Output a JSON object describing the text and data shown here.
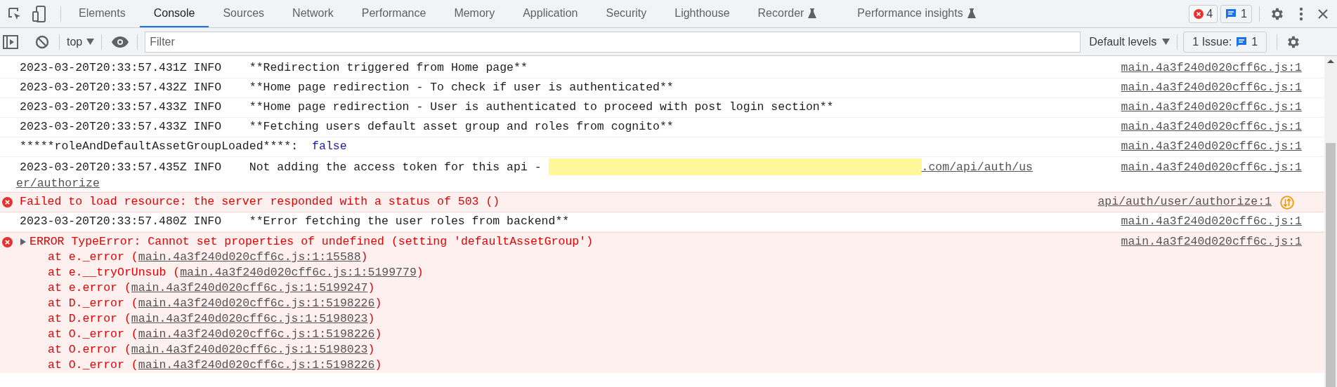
{
  "tabs": [
    {
      "label": "Elements",
      "selected": false,
      "experimental": false
    },
    {
      "label": "Console",
      "selected": true,
      "experimental": false
    },
    {
      "label": "Sources",
      "selected": false,
      "experimental": false
    },
    {
      "label": "Network",
      "selected": false,
      "experimental": false
    },
    {
      "label": "Performance",
      "selected": false,
      "experimental": false
    },
    {
      "label": "Memory",
      "selected": false,
      "experimental": false
    },
    {
      "label": "Application",
      "selected": false,
      "experimental": false
    },
    {
      "label": "Security",
      "selected": false,
      "experimental": false
    },
    {
      "label": "Lighthouse",
      "selected": false,
      "experimental": false
    },
    {
      "label": "Recorder",
      "selected": false,
      "experimental": true
    },
    {
      "label": "Performance insights",
      "selected": false,
      "experimental": true
    }
  ],
  "error_count": "4",
  "message_count": "1",
  "toolbar": {
    "context": "top",
    "filter_placeholder": "Filter",
    "levels": "Default levels",
    "issues_label": "1 Issue:",
    "issues_count": "1"
  },
  "entries": [
    {
      "kind": "info",
      "text": "2023-03-20T20:33:57.431Z INFO    **Redirection triggered from Home page**",
      "source": "main.4a3f240d020cff6c.js:1"
    },
    {
      "kind": "info",
      "text": "2023-03-20T20:33:57.432Z INFO    **Home page redirection - To check if user is authenticated**",
      "source": "main.4a3f240d020cff6c.js:1"
    },
    {
      "kind": "info",
      "text": "2023-03-20T20:33:57.433Z INFO    **Home page redirection - User is authenticated to proceed with post login section**",
      "source": "main.4a3f240d020cff6c.js:1"
    },
    {
      "kind": "info",
      "text": "2023-03-20T20:33:57.433Z INFO    **Fetching users default asset group and roles from cognito**",
      "source": "main.4a3f240d020cff6c.js:1"
    },
    {
      "kind": "value",
      "text": "*****roleAndDefaultAssetGroupLoaded****:",
      "value": "false",
      "source": "main.4a3f240d020cff6c.js:1"
    },
    {
      "kind": "redacted",
      "text": "2023-03-20T20:33:57.435Z INFO    Not adding the access token for this api - ",
      "url": ".com/api/auth/us",
      "url_continued": "er/authorize",
      "source": "main.4a3f240d020cff6c.js:1"
    },
    {
      "kind": "network_error",
      "text": "Failed to load resource: the server responded with a status of 503 ()",
      "source": "api/auth/user/authorize:1"
    },
    {
      "kind": "info",
      "text": "2023-03-20T20:33:57.480Z INFO    **Error fetching the user roles from backend**",
      "source": "main.4a3f240d020cff6c.js:1"
    },
    {
      "kind": "error",
      "expanded": false,
      "text": "ERROR TypeError: Cannot set properties of undefined (setting 'defaultAssetGroup')",
      "source": "main.4a3f240d020cff6c.js:1",
      "stack": [
        {
          "call": "at e._error (",
          "location": "main.4a3f240d020cff6c.js:1:15588",
          "close": ")"
        },
        {
          "call": "at e.__tryOrUnsub (",
          "location": "main.4a3f240d020cff6c.js:1:5199779",
          "close": ")"
        },
        {
          "call": "at e.error (",
          "location": "main.4a3f240d020cff6c.js:1:5199247",
          "close": ")"
        },
        {
          "call": "at D._error (",
          "location": "main.4a3f240d020cff6c.js:1:5198226",
          "close": ")"
        },
        {
          "call": "at D.error (",
          "location": "main.4a3f240d020cff6c.js:1:5198023",
          "close": ")"
        },
        {
          "call": "at O._error (",
          "location": "main.4a3f240d020cff6c.js:1:5198226",
          "close": ")"
        },
        {
          "call": "at O.error (",
          "location": "main.4a3f240d020cff6c.js:1:5198023",
          "close": ")"
        },
        {
          "call": "at O._error (",
          "location": "main.4a3f240d020cff6c.js:1:5198226",
          "close": ")"
        }
      ]
    }
  ]
}
